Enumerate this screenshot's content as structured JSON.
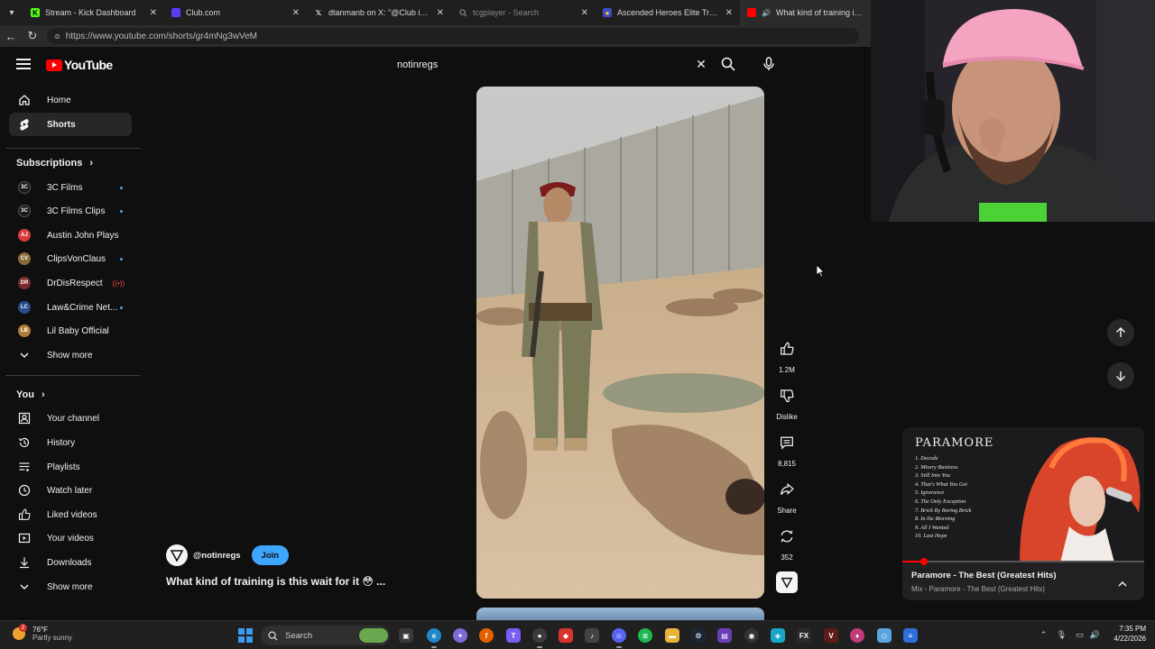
{
  "browser": {
    "tabs": [
      {
        "title": "Stream - Kick Dashboard",
        "icon": "kick-icon",
        "color": "#53fc18"
      },
      {
        "title": "Club.com",
        "icon": "club-icon",
        "color": "#5b3cf5"
      },
      {
        "title": "dtanmanb on X: \"@Club im curiou",
        "icon": "x-icon",
        "color": "#ffffff"
      },
      {
        "title": "tcgplayer - Search",
        "icon": "search-icon",
        "color": "#888888"
      },
      {
        "title": "Ascended Heroes Elite Trainer Box",
        "icon": "pokemon-icon",
        "color": "#3b4cca"
      },
      {
        "title": "What kind of training is this w",
        "icon": "youtube-icon",
        "color": "#ff0000"
      }
    ],
    "url": "https://www.youtube.com/shorts/gr4mNg3wVeM"
  },
  "youtube": {
    "logo": "YouTube",
    "search_query": "notinregs",
    "sidebar": {
      "main": [
        {
          "label": "Home",
          "icon": "home-icon"
        },
        {
          "label": "Shorts",
          "icon": "shorts-icon",
          "selected": true
        }
      ],
      "subscriptions_title": "Subscriptions",
      "subscriptions": [
        {
          "label": "3C Films",
          "avatar": "3C",
          "color": "#1a1a1a",
          "dot": true
        },
        {
          "label": "3C Films Clips",
          "avatar": "3C",
          "color": "#1a1a1a",
          "dot": true
        },
        {
          "label": "Austin John Plays",
          "avatar": "AJ",
          "color": "#d93a3a",
          "dot": false
        },
        {
          "label": "ClipsVonClaus",
          "avatar": "CV",
          "color": "#8a6a3a",
          "dot": true
        },
        {
          "label": "DrDisRespect",
          "avatar": "DR",
          "color": "#7a2a2a",
          "live": true
        },
        {
          "label": "Law&Crime Net...",
          "avatar": "LC",
          "color": "#2a4a8a",
          "dot": true
        },
        {
          "label": "Lil Baby Official",
          "avatar": "LB",
          "color": "#b07a3a",
          "dot": false
        }
      ],
      "subs_show_more": "Show more",
      "you_title": "You",
      "you_items": [
        {
          "label": "Your channel",
          "icon": "channel-icon"
        },
        {
          "label": "History",
          "icon": "history-icon"
        },
        {
          "label": "Playlists",
          "icon": "playlists-icon"
        },
        {
          "label": "Watch later",
          "icon": "watch-later-icon"
        },
        {
          "label": "Liked videos",
          "icon": "liked-icon"
        },
        {
          "label": "Your videos",
          "icon": "your-videos-icon"
        },
        {
          "label": "Downloads",
          "icon": "downloads-icon"
        }
      ],
      "you_show_more": "Show more"
    },
    "short": {
      "channel_handle": "@notinregs",
      "join_label": "Join",
      "title": "What kind of training is this wait for it 😳 ...",
      "actions": {
        "likes": "1.2M",
        "dislike_label": "Dislike",
        "comments": "8,815",
        "share_label": "Share",
        "remixes": "352"
      }
    },
    "miniplayer": {
      "band": "PARAMORE",
      "tracklist": [
        "1. Decode",
        "2. Misery Business",
        "3. Still Into You",
        "4. That's What You Get",
        "5. Ignorance",
        "6. The Only Exception",
        "7. Brick By Boring Brick",
        "8. In the Morning",
        "9. All I Wanted",
        "10. Last Hope"
      ],
      "title": "Paramore - The Best (Greatest Hits)",
      "subtitle": "Mix - Paramore - The Best (Greatest Hits)",
      "progress": 0.09
    }
  },
  "taskbar": {
    "temperature": "76°F",
    "condition": "Partly sunny",
    "weather_badge": "2",
    "search_label": "Search",
    "time": "7:35 PM",
    "date": "4/22/2026"
  },
  "colors": {
    "accent_blue": "#3ea6ff",
    "youtube_red": "#ff0000",
    "background": "#0f0f0f"
  }
}
